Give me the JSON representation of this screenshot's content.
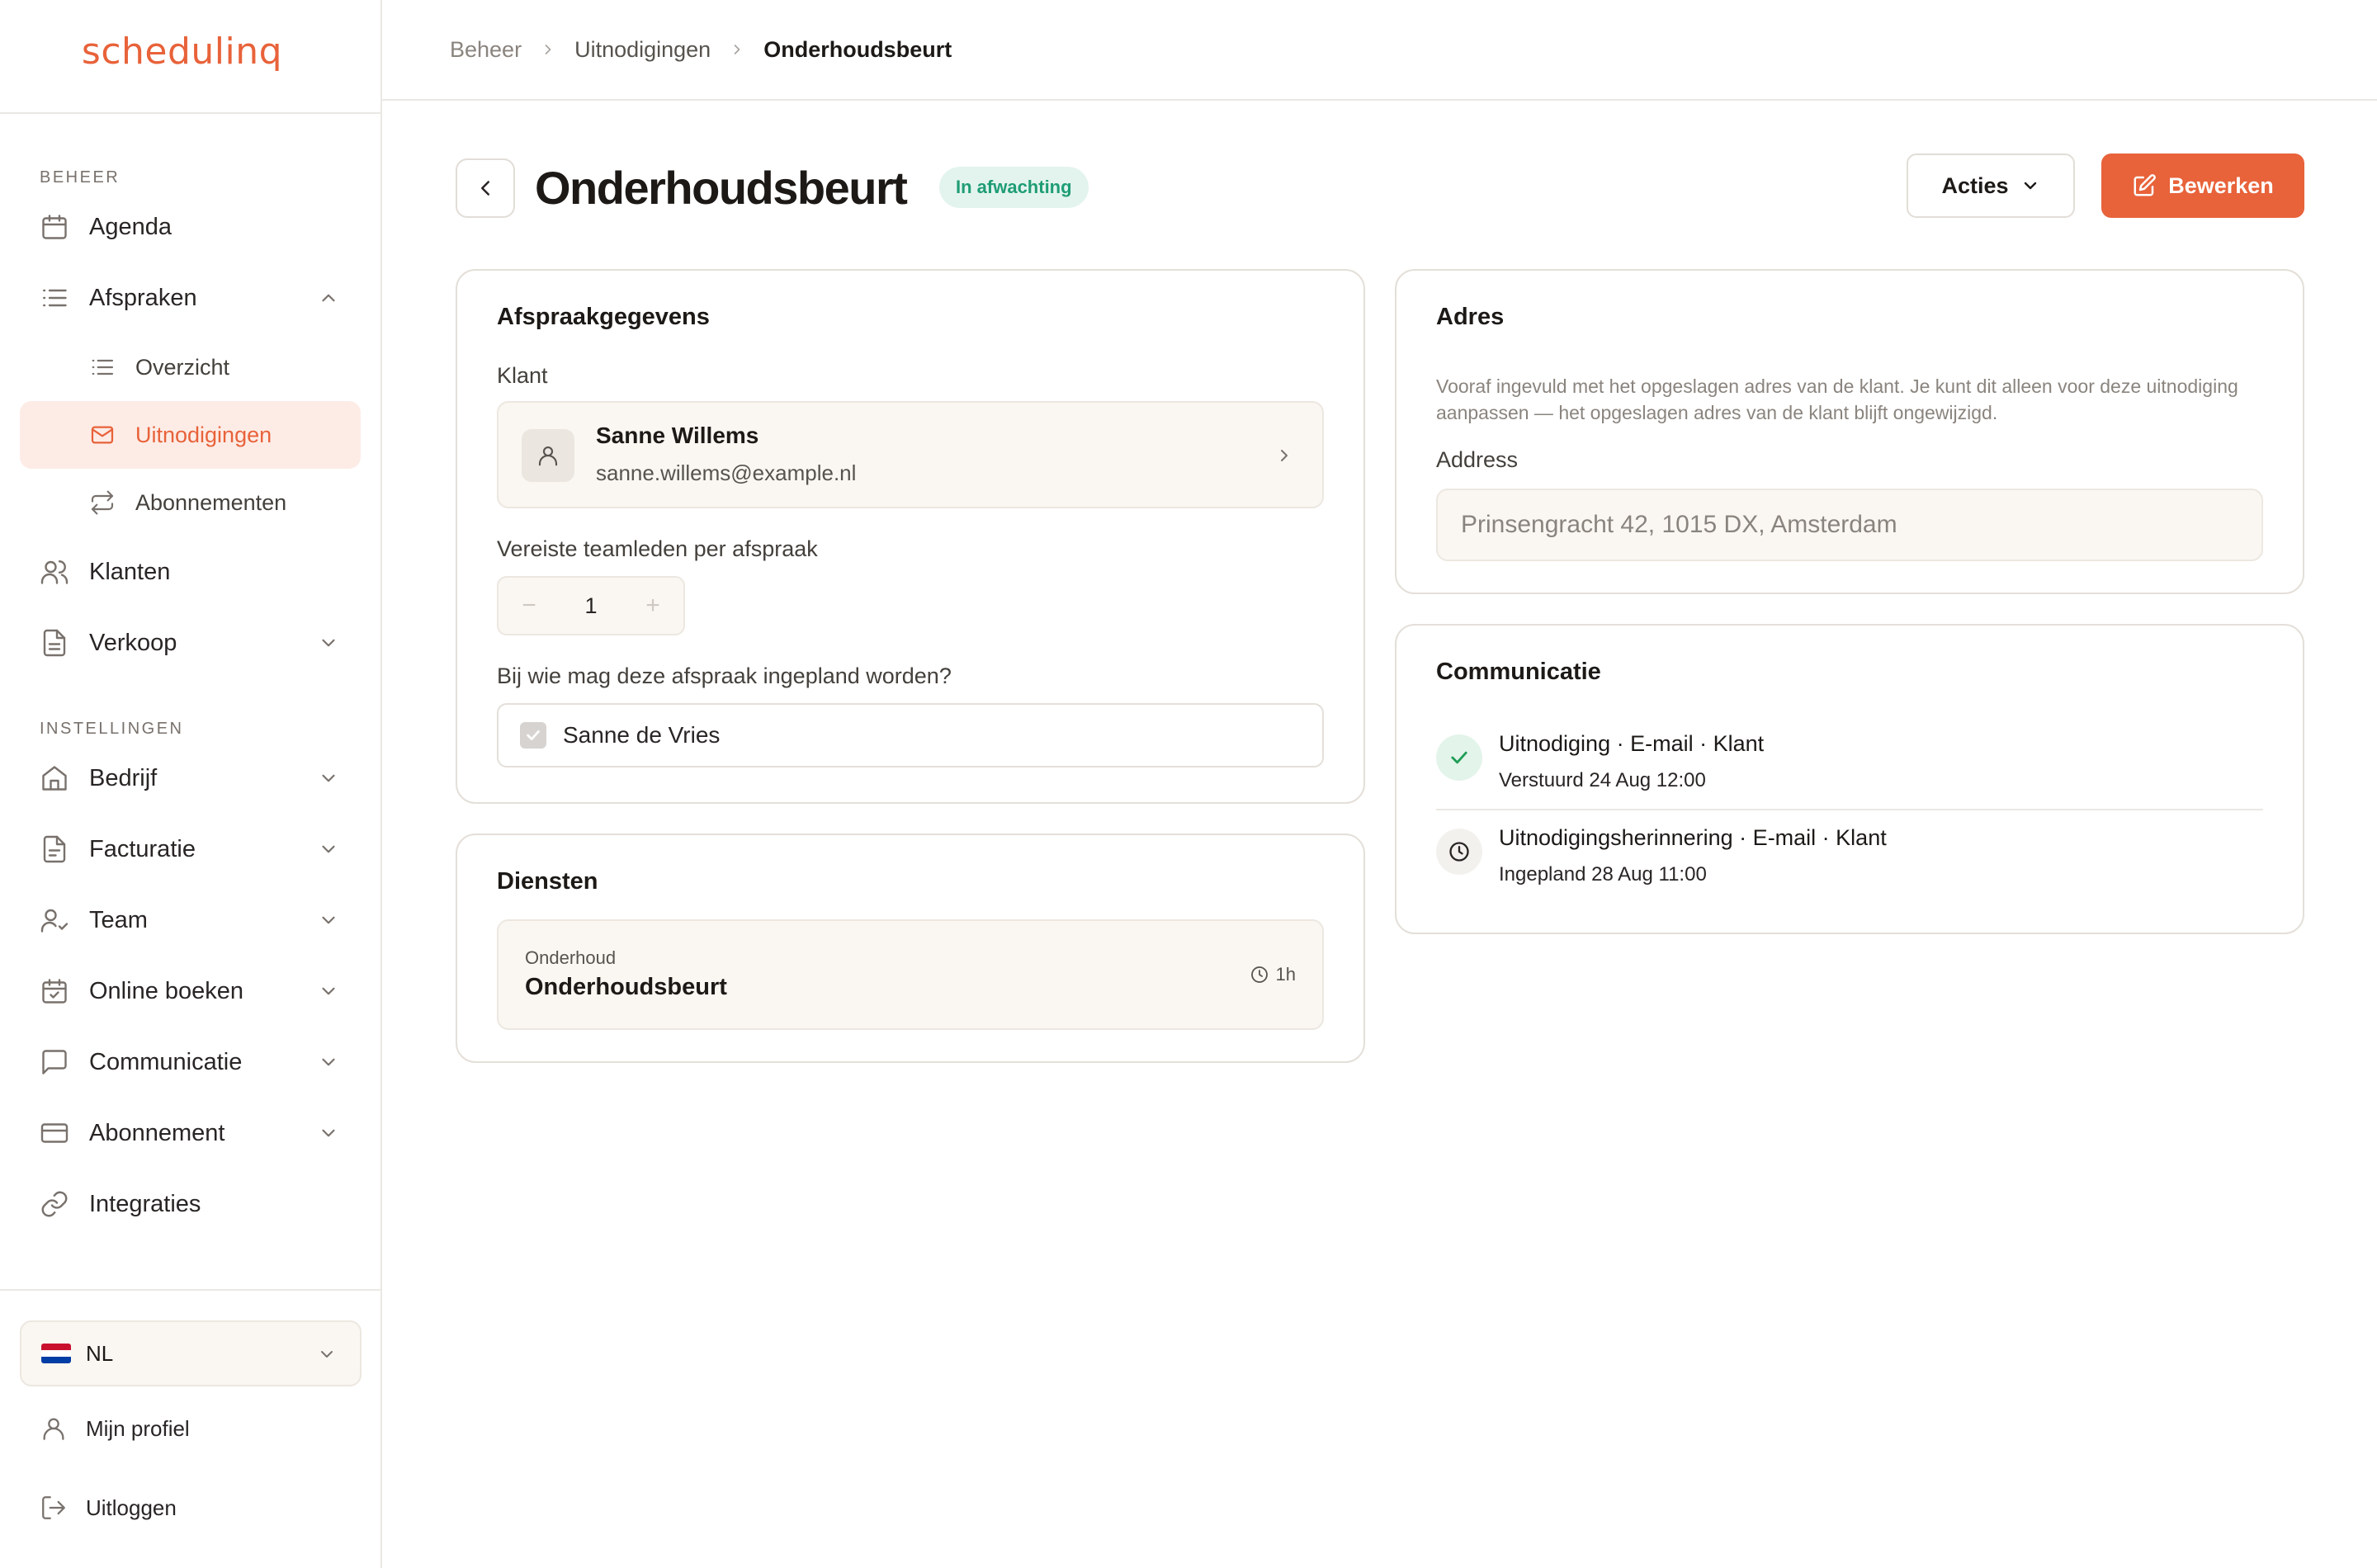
{
  "app": {
    "logo": "schedulinq"
  },
  "sidebar": {
    "sections": {
      "beheer": "BEHEER",
      "instellingen": "INSTELLINGEN"
    },
    "items": {
      "agenda": "Agenda",
      "afspraken": "Afspraken",
      "overzicht": "Overzicht",
      "uitnodigingen": "Uitnodigingen",
      "abonnementen": "Abonnementen",
      "klanten": "Klanten",
      "verkoop": "Verkoop",
      "bedrijf": "Bedrijf",
      "facturatie": "Facturatie",
      "team": "Team",
      "online_boeken": "Online boeken",
      "communicatie": "Communicatie",
      "abonnement": "Abonnement",
      "integraties": "Integraties"
    },
    "language": "NL",
    "profile": "Mijn profiel",
    "logout": "Uitloggen"
  },
  "breadcrumb": [
    "Beheer",
    "Uitnodigingen",
    "Onderhoudsbeurt"
  ],
  "header": {
    "title": "Onderhoudsbeurt",
    "status": "In afwachting",
    "actions_label": "Acties",
    "edit_label": "Bewerken"
  },
  "details": {
    "title": "Afspraakgegevens",
    "client_label": "Klant",
    "client_name": "Sanne Willems",
    "client_email": "sanne.willems@example.nl",
    "team_label": "Vereiste teamleden per afspraak",
    "team_count": "1",
    "minus": "−",
    "plus": "+",
    "assign_label": "Bij wie mag deze afspraak ingepland worden?",
    "member": "Sanne de Vries"
  },
  "services": {
    "title": "Diensten",
    "items": [
      {
        "category": "Onderhoud",
        "name": "Onderhoudsbeurt",
        "duration": "1h"
      }
    ]
  },
  "address": {
    "title": "Adres",
    "help": "Vooraf ingevuld met het opgeslagen adres van de klant. Je kunt dit alleen voor deze uitnodiging aanpassen — het opgeslagen adres van de klant blijft ongewijzigd.",
    "label": "Address",
    "placeholder": "Prinsengracht 42, 1015 DX, Amsterdam"
  },
  "communication": {
    "title": "Communicatie",
    "items": [
      {
        "title": "Uitnodiging · E-mail · Klant",
        "sub": "Verstuurd 24 Aug 12:00",
        "status": "sent"
      },
      {
        "title": "Uitnodigingsherinnering · E-mail · Klant",
        "sub": "Ingepland 28 Aug 11:00",
        "status": "scheduled"
      }
    ]
  },
  "colors": {
    "accent": "#e8623a",
    "success": "#1f9d74",
    "badge_bg": "#e3f4ee"
  }
}
